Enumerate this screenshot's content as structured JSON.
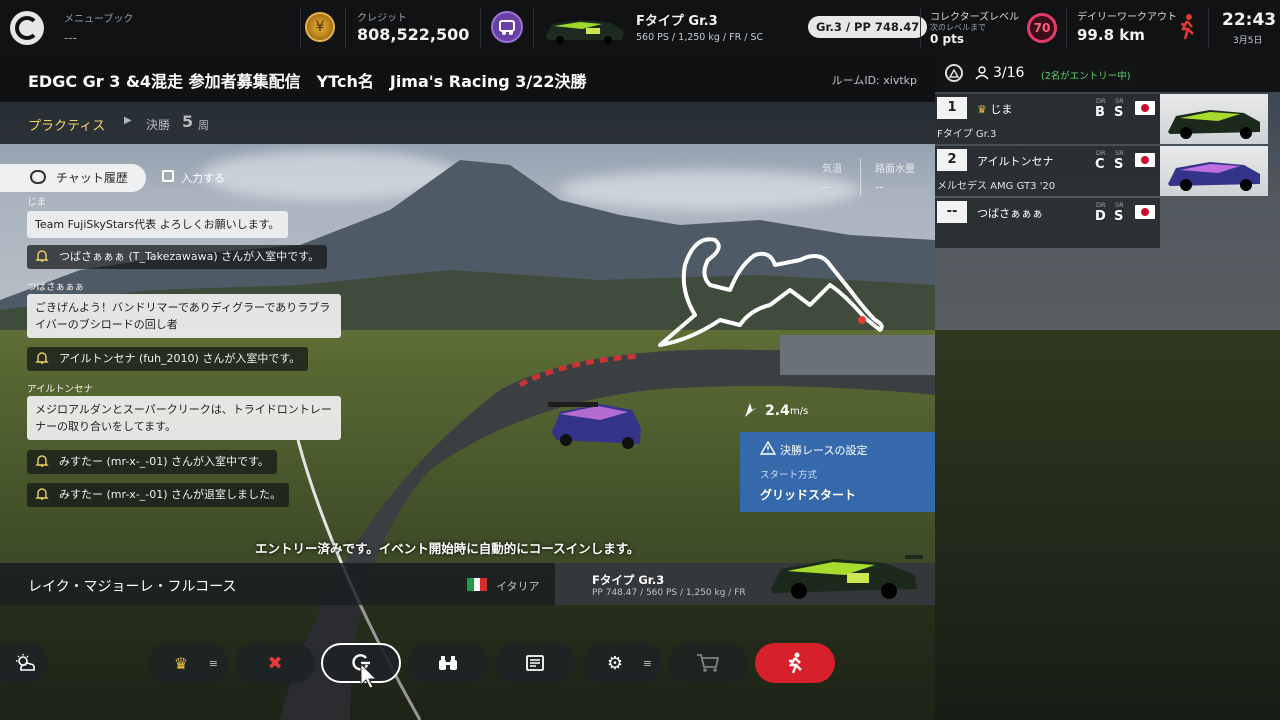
{
  "topbar": {
    "menu_book_label": "メニューブック",
    "menu_book_value": "---",
    "credits_label": "クレジット",
    "credits_value": "808,522,500",
    "car_name": "Fタイプ Gr.3",
    "car_specs": "560 PS / 1,250 kg / FR / SC",
    "pp_badge": "Gr.3 / PP 748.47",
    "collector_label": "コレクターズレベル",
    "collector_next": "次のレベルまで",
    "collector_pts": "0 pts",
    "collector_level": "70",
    "workout_label": "デイリーワークアウト",
    "workout_value": "99.8 km",
    "time": "22:43",
    "date": "3月5日"
  },
  "title": {
    "room_title": "EDGC Gr 3 &4混走 参加者募集配信　YTch名　Jima's Racing 3/22決勝",
    "room_id": "ルームID: xivtkp"
  },
  "session": {
    "practice": "プラクティス",
    "final": "決勝",
    "laps": "5",
    "laps_unit": "周"
  },
  "chat": {
    "history_button": "チャット履歴",
    "input_button": "入力する",
    "messages": [
      {
        "type": "name",
        "text": "じま"
      },
      {
        "type": "msg",
        "text": "Team FujiSkyStars代表 よろしくお願いします。"
      },
      {
        "type": "sys",
        "text": "つばさぁぁぁ (T_Takezawawa) さんが入室中です。"
      },
      {
        "type": "name",
        "text": "つばさぁぁぁ"
      },
      {
        "type": "msg",
        "text": "ごきげんよう！バンドリマーでありディグラーでありラブラ"
      },
      {
        "type": "msg",
        "text": "イバーのブシロードの回し者"
      },
      {
        "type": "sys",
        "text": "アイルトンセナ (fuh_2010) さんが入室中です。"
      },
      {
        "type": "name",
        "text": "アイルトンセナ"
      },
      {
        "type": "msg",
        "text": "メジロアルダンとスーパークリークは、トライドロントレー"
      },
      {
        "type": "msg",
        "text": "ナーの取り合いをしてます。"
      },
      {
        "type": "sys",
        "text": "みすたー (mr-x-_-01) さんが入室中です。"
      },
      {
        "type": "sys",
        "text": "みすたー (mr-x-_-01) さんが退室しました。"
      }
    ]
  },
  "weather": {
    "temp_label": "気温",
    "temp_value": "--",
    "water_label": "路面水量",
    "water_value": "--"
  },
  "speed": {
    "value": "2.4",
    "unit": "m/s"
  },
  "final_settings": {
    "title": "決勝レースの設定",
    "start_label": "スタート方式",
    "start_value": "グリッドスタート"
  },
  "entry_notice": "エントリー済みです。イベント開始時に自動的にコースインします。",
  "course": {
    "name": "レイク・マジョーレ・フルコース",
    "country": "イタリア",
    "car_type": "Fタイプ Gr.3",
    "car_specs": "PP 748.47 / 560 PS / 1,250 kg / FR"
  },
  "lobby": {
    "count": "3/16",
    "entries_note": "(2名がエントリー中)",
    "players": [
      {
        "num": "1",
        "name": "じま",
        "host": true,
        "dr_label": "DR",
        "sr_label": "SR",
        "dr": "B",
        "sr": "S",
        "car": "Fタイプ Gr.3"
      },
      {
        "num": "2",
        "name": "アイルトンセナ",
        "host": false,
        "dr_label": "DR",
        "sr_label": "SR",
        "dr": "C",
        "sr": "S",
        "car": "メルセデス AMG GT3 '20"
      },
      {
        "num": "--",
        "name": "つばさぁぁぁ",
        "host": false,
        "dr_label": "DR",
        "sr_label": "SR",
        "dr": "D",
        "sr": "S",
        "car": ""
      }
    ]
  },
  "buttons": {
    "menu_glyph": "≡"
  },
  "colors": {
    "accent_yellow": "#f5d36a",
    "final_panel_blue": "#346cbe",
    "exit_red": "#d8202a",
    "entries_green": "#5cd66a",
    "level_pink": "#e63a68"
  }
}
